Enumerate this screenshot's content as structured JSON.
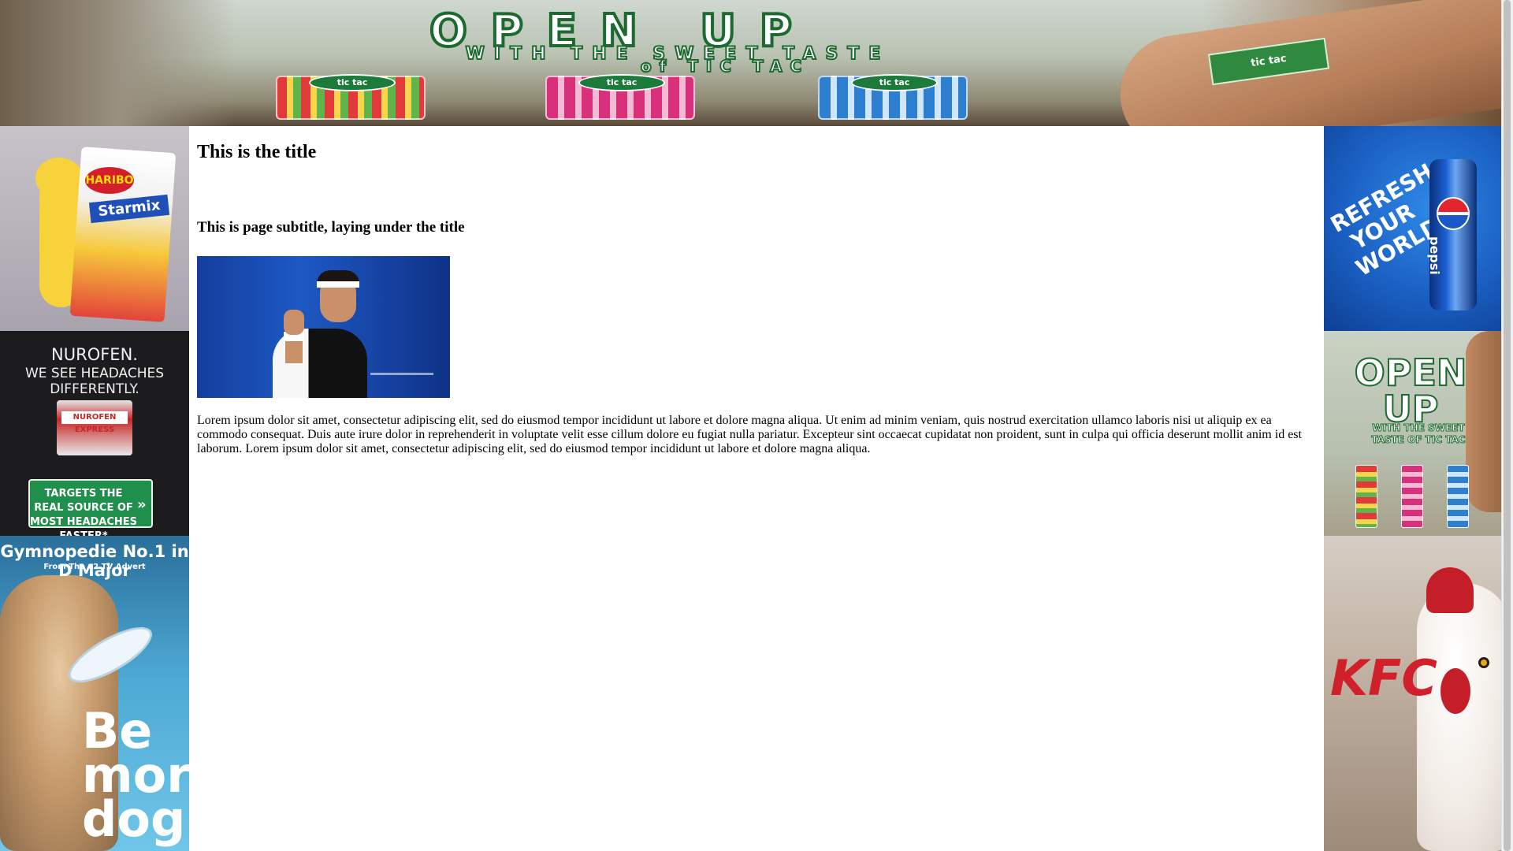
{
  "banner": {
    "headline": "OPEN UP",
    "subline1": "WITH THE SWEET TASTE",
    "subline2": "of TIC TAC",
    "pack_label": "tic tac"
  },
  "left_ads": {
    "haribo": {
      "brand": "HARIBO",
      "product": "Starmix"
    },
    "nurofen": {
      "line1": "NUROFEN.",
      "line2": "WE SEE HEADACHES DIFFERENTLY.",
      "pack_brand": "NUROFEN EXPRESS",
      "box_text": "TARGETS THE REAL SOURCE OF MOST HEADACHES FASTER*",
      "arrow": "»"
    },
    "o2": {
      "title": "Gymnopedie No.1 in D Major",
      "subtitle": "From The o2 TV Advert",
      "slogan": "Be more dog"
    }
  },
  "right_ads": {
    "pepsi": {
      "slogan": "REFRESH YOUR WORLD",
      "brand": "pepsi"
    },
    "tictac": {
      "title": "OPEN UP",
      "subtitle": "WITH THE SWEET TASTE OF TIC TAC"
    },
    "kfc": {
      "logo": "KFC"
    }
  },
  "main": {
    "title": "This is the title",
    "subtitle": "This is page subtitle, laying under the title",
    "body": "Lorem ipsum dolor sit amet, consectetur adipiscing elit, sed do eiusmod tempor incididunt ut labore et dolore magna aliqua. Ut enim ad minim veniam, quis nostrud exercitation ullamco laboris nisi ut aliquip ex ea commodo consequat. Duis aute irure dolor in reprehenderit in voluptate velit esse cillum dolore eu fugiat nulla pariatur. Excepteur sint occaecat cupidatat non proident, sunt in culpa qui officia deserunt mollit anim id est laborum. Lorem ipsum dolor sit amet, consectetur adipiscing elit, sed do eiusmod tempor incididunt ut labore et dolore magna aliqua."
  }
}
